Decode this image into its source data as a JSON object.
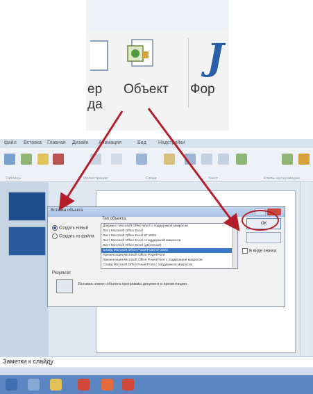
{
  "zoom": {
    "left_text_line1": "ер",
    "left_text_line2": "да",
    "object_label": "Объект",
    "right_text": "Фор",
    "icons": [
      "document-icon",
      "insert-object-icon",
      "wordart-icon"
    ]
  },
  "app": {
    "menu": [
      "файл",
      "Вставка",
      "Главная",
      "Дизайн",
      "Анимация",
      "Вид",
      "Надстройки"
    ],
    "ribbon_icons": [
      "table-icon",
      "picture-icon",
      "clipart-icon",
      "chart-icon",
      "shapes-icon",
      "textbox-icon",
      "header-icon",
      "wordart-icon",
      "date-icon",
      "slide-number-icon",
      "symbol-icon",
      "object-icon",
      "movie-icon",
      "sound-icon"
    ],
    "ribbon_groups": [
      "Таблицы",
      "Иллюстрации",
      "Связи",
      "Текст",
      "Клипы мультимедиа"
    ],
    "notes_title": "Заметки к слайду",
    "colors": {
      "taskbar": "#5b86c2",
      "annotation": "#b41e2a",
      "selection": "#3a78c8"
    }
  },
  "dialog": {
    "title": "Вставка объекта",
    "radio_create_new": "Создать новый",
    "radio_from_file": "Создать из файла",
    "type_label": "Тип объекта:",
    "items": [
      "Документ Microsoft Office Word с поддержкой макросов",
      "Лист Microsoft Office Excel",
      "Лист Microsoft Office Excel 97-2003",
      "Лист Microsoft Office Excel с поддержкой макросов",
      "Лист Microsoft Office Excel (двоичный)",
      "Слайд Microsoft Office PowerPoint 97-2003",
      "Презентация Microsoft Office PowerPoint",
      "Презентация Microsoft Office PowerPoint с поддержкой макросов",
      "Слайд Microsoft Office PowerPoint с поддержкой макросов"
    ],
    "selected_index": 5,
    "ok_label": "ОК",
    "as_icon_label": "В виде значка",
    "result_label": "Результат",
    "result_text": "Вставка нового объекта программы документ в презентацию."
  }
}
